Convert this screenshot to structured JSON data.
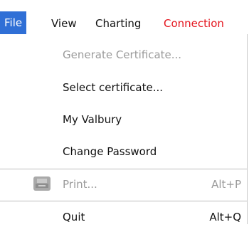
{
  "menubar": {
    "items": [
      {
        "label": "File"
      },
      {
        "label": "View"
      },
      {
        "label": "Charting"
      },
      {
        "label": "Connection"
      }
    ]
  },
  "file_menu": {
    "items": [
      {
        "label": "Generate Certificate...",
        "enabled": false
      },
      {
        "label": "Select certificate...",
        "enabled": true
      },
      {
        "label": "My Valbury",
        "enabled": true
      },
      {
        "label": "Change Password",
        "enabled": true
      },
      {
        "label": "Print...",
        "shortcut": "Alt+P",
        "enabled": false,
        "icon": "printer-icon"
      },
      {
        "label": "Quit",
        "shortcut": "Alt+Q",
        "enabled": true
      }
    ]
  },
  "colors": {
    "active_menu": "#2f6fd6",
    "connection_text": "#e4141d",
    "disabled_text": "#9a9a9a"
  }
}
